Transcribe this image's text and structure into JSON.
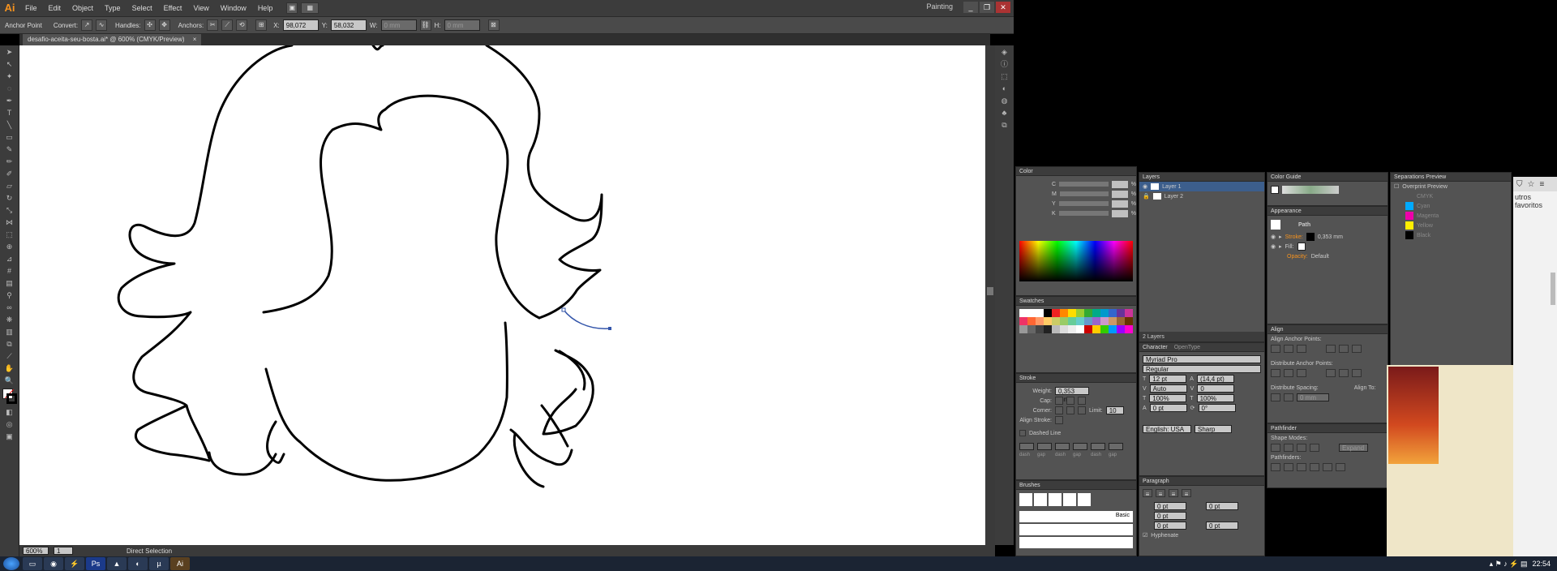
{
  "app": {
    "logo": "Ai"
  },
  "menu": [
    "File",
    "Edit",
    "Object",
    "Type",
    "Select",
    "Effect",
    "View",
    "Window",
    "Help"
  ],
  "workspace": "Painting",
  "window_buttons": [
    "_",
    "❐",
    "✕"
  ],
  "control_bar": {
    "anchor_point": "Anchor Point",
    "convert": "Convert:",
    "handles": "Handles:",
    "anchors": "Anchors:",
    "x_value": "98,072 mm",
    "y_value": "58,032 mm",
    "w_value": "0 mm",
    "h_value": "0 mm"
  },
  "document_tab": {
    "title": "desafio-aceita-seu-bosta.ai* @ 600% (CMYK/Preview)",
    "close": "×"
  },
  "status": {
    "zoom": "600%",
    "page": "1",
    "tool": "Direct Selection"
  },
  "panels": {
    "color": {
      "title": "Color",
      "channels": [
        "C",
        "M",
        "Y",
        "K"
      ],
      "unit": "%"
    },
    "swatches": {
      "title": "Swatches"
    },
    "stroke": {
      "title": "Stroke",
      "weight_label": "Weight:",
      "weight": "0,353 mm",
      "cap_label": "Cap:",
      "corner_label": "Corner:",
      "limit_label": "Limit:",
      "limit": "10",
      "align_label": "Align Stroke:",
      "dashed_label": "Dashed Line",
      "dash_labels": [
        "dash",
        "gap",
        "dash",
        "gap",
        "dash",
        "gap"
      ]
    },
    "brushes": {
      "title": "Brushes",
      "basic": "Basic"
    },
    "layers": {
      "title": "Layers",
      "items": [
        "Layer 1",
        "Layer 2"
      ],
      "count": "2 Layers"
    },
    "character": {
      "title": "Character",
      "tab2": "OpenType",
      "font": "Myriad Pro",
      "style": "Regular",
      "size": "12 pt",
      "leading": "(14,4 pt)",
      "tracking": "Auto",
      "kerning": "0",
      "hscale": "100%",
      "vscale": "100%",
      "baseline": "0 pt",
      "rotation": "0°",
      "language": "English: USA",
      "aa": "Sharp"
    },
    "paragraph": {
      "title": "Paragraph",
      "values": [
        "0 pt",
        "0 pt",
        "0 pt",
        "0 pt",
        "0 pt"
      ],
      "hyphenate": "Hyphenate"
    },
    "color_guide": {
      "title": "Color Guide"
    },
    "appearance": {
      "title": "Appearance",
      "object": "Path",
      "stroke_label": "Stroke:",
      "stroke_value": "0,353 mm",
      "fill_label": "Fill:",
      "opacity_label": "Opacity:",
      "opacity_value": "Default"
    },
    "align": {
      "title": "Align",
      "anchor_points": "Align Anchor Points:",
      "distribute_anchor": "Distribute Anchor Points:",
      "distribute_spacing": "Distribute Spacing:",
      "align_to": "Align To:",
      "spacing_value": "0 mm"
    },
    "pathfinder": {
      "title": "Pathfinder",
      "shape_modes": "Shape Modes:",
      "expand": "Expand",
      "pathfinders": "Pathfinders:"
    },
    "separations": {
      "title": "Separations Preview",
      "overprint": "Overprint Preview",
      "plates": [
        "CMYK",
        "Cyan",
        "Magenta",
        "Yellow",
        "Black"
      ]
    }
  },
  "browser": {
    "favorites": "utros favoritos"
  },
  "taskbar": {
    "time": "22:54"
  },
  "colors": {
    "accent": "#f7931e",
    "panel": "#535353",
    "panel_dark": "#3c3c3c",
    "selection": "#3355aa"
  }
}
